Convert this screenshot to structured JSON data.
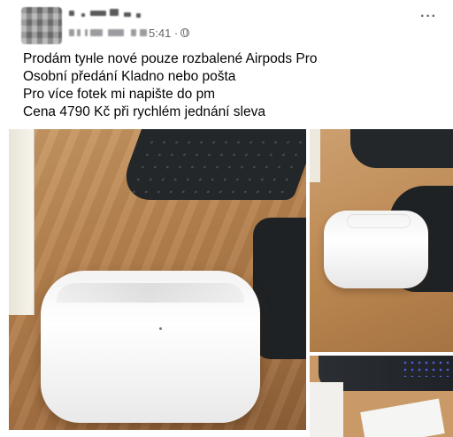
{
  "post": {
    "meta_time": "5:41 ·",
    "more_label": "···",
    "text_lines": [
      "Prodám tyнle nové pouze rozbalené Airpods Pro",
      "Osobní předání Kladno nebo pošta",
      "Pro více fotek mi napište do pm",
      "Cena 4790 Kč při rychlém jednání sleva"
    ]
  },
  "icons": {
    "privacy": "globe-icon",
    "more": "more-dots-icon"
  },
  "colors": {
    "text": "#050505",
    "meta": "#65676b"
  }
}
